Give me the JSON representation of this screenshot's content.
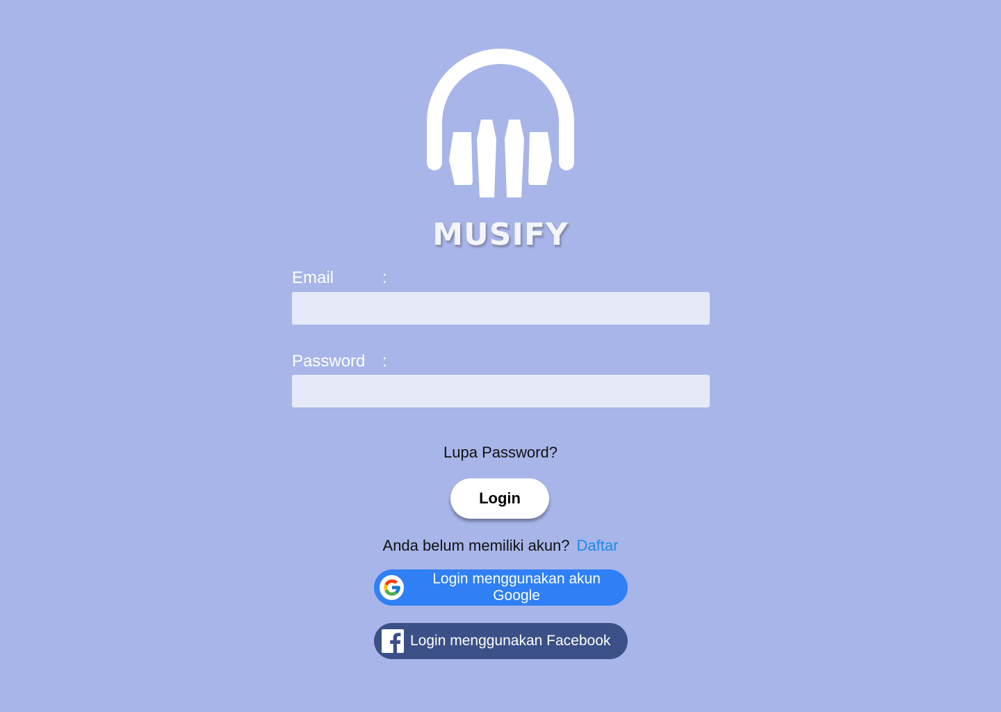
{
  "app": {
    "brand_name": "MUSIFY",
    "logo_icon": "headphones-icon"
  },
  "form": {
    "email_label": "Email",
    "email_colon": ":",
    "email_value": "",
    "password_label": "Password",
    "password_colon": ":",
    "password_value": "",
    "forgot_password": "Lupa Password?",
    "login_button": "Login"
  },
  "signup": {
    "prompt": "Anda belum memiliki akun?",
    "link": "Daftar"
  },
  "social": {
    "google_label": "Login menggunakan akun Google",
    "google_icon": "google-icon",
    "facebook_label": "Login menggunakan Facebook",
    "facebook_icon": "facebook-icon"
  },
  "colors": {
    "background": "#a7b5e9",
    "input_bg": "#e6e9f8",
    "link": "#1e88e5",
    "google_button": "#2e80f4",
    "facebook_button": "#3b5087"
  }
}
